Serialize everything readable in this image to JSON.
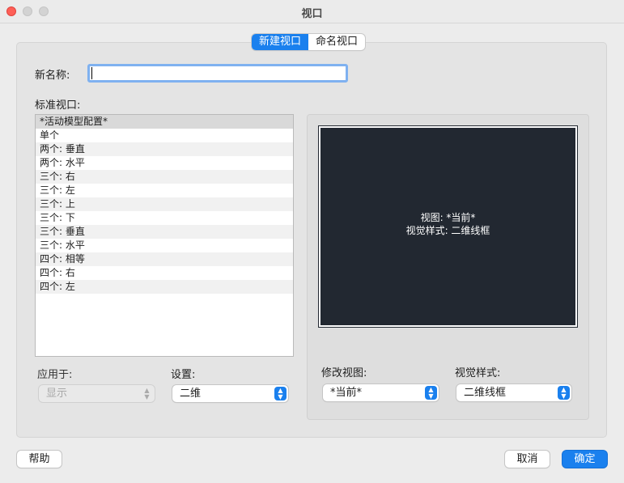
{
  "window": {
    "title": "视口"
  },
  "tabs": [
    {
      "label": "新建视口",
      "active": true
    },
    {
      "label": "命名视口",
      "active": false
    }
  ],
  "new_name": {
    "label": "新名称:",
    "value": ""
  },
  "standard": {
    "label": "标准视口:",
    "items": [
      "*活动模型配置*",
      "单个",
      "两个:  垂直",
      "两个:  水平",
      "三个: 右",
      "三个: 左",
      "三个: 上",
      "三个: 下",
      "三个: 垂直",
      "三个: 水平",
      "四个:  相等",
      "四个:  右",
      "四个:  左"
    ],
    "selected_index": 0
  },
  "apply_to": {
    "label": "应用于:",
    "value": "显示",
    "disabled": true
  },
  "setup": {
    "label": "设置:",
    "value": "二维"
  },
  "preview": {
    "line1": "视图: *当前*",
    "line2": "视觉样式: 二维线框"
  },
  "change_view": {
    "label": "修改视图:",
    "value": "*当前*"
  },
  "visual_style": {
    "label": "视觉样式:",
    "value": "二维线框"
  },
  "buttons": {
    "help": "帮助",
    "cancel": "取消",
    "ok": "确定"
  },
  "colors": {
    "accent": "#1a80ee",
    "preview_bg": "#222831"
  }
}
